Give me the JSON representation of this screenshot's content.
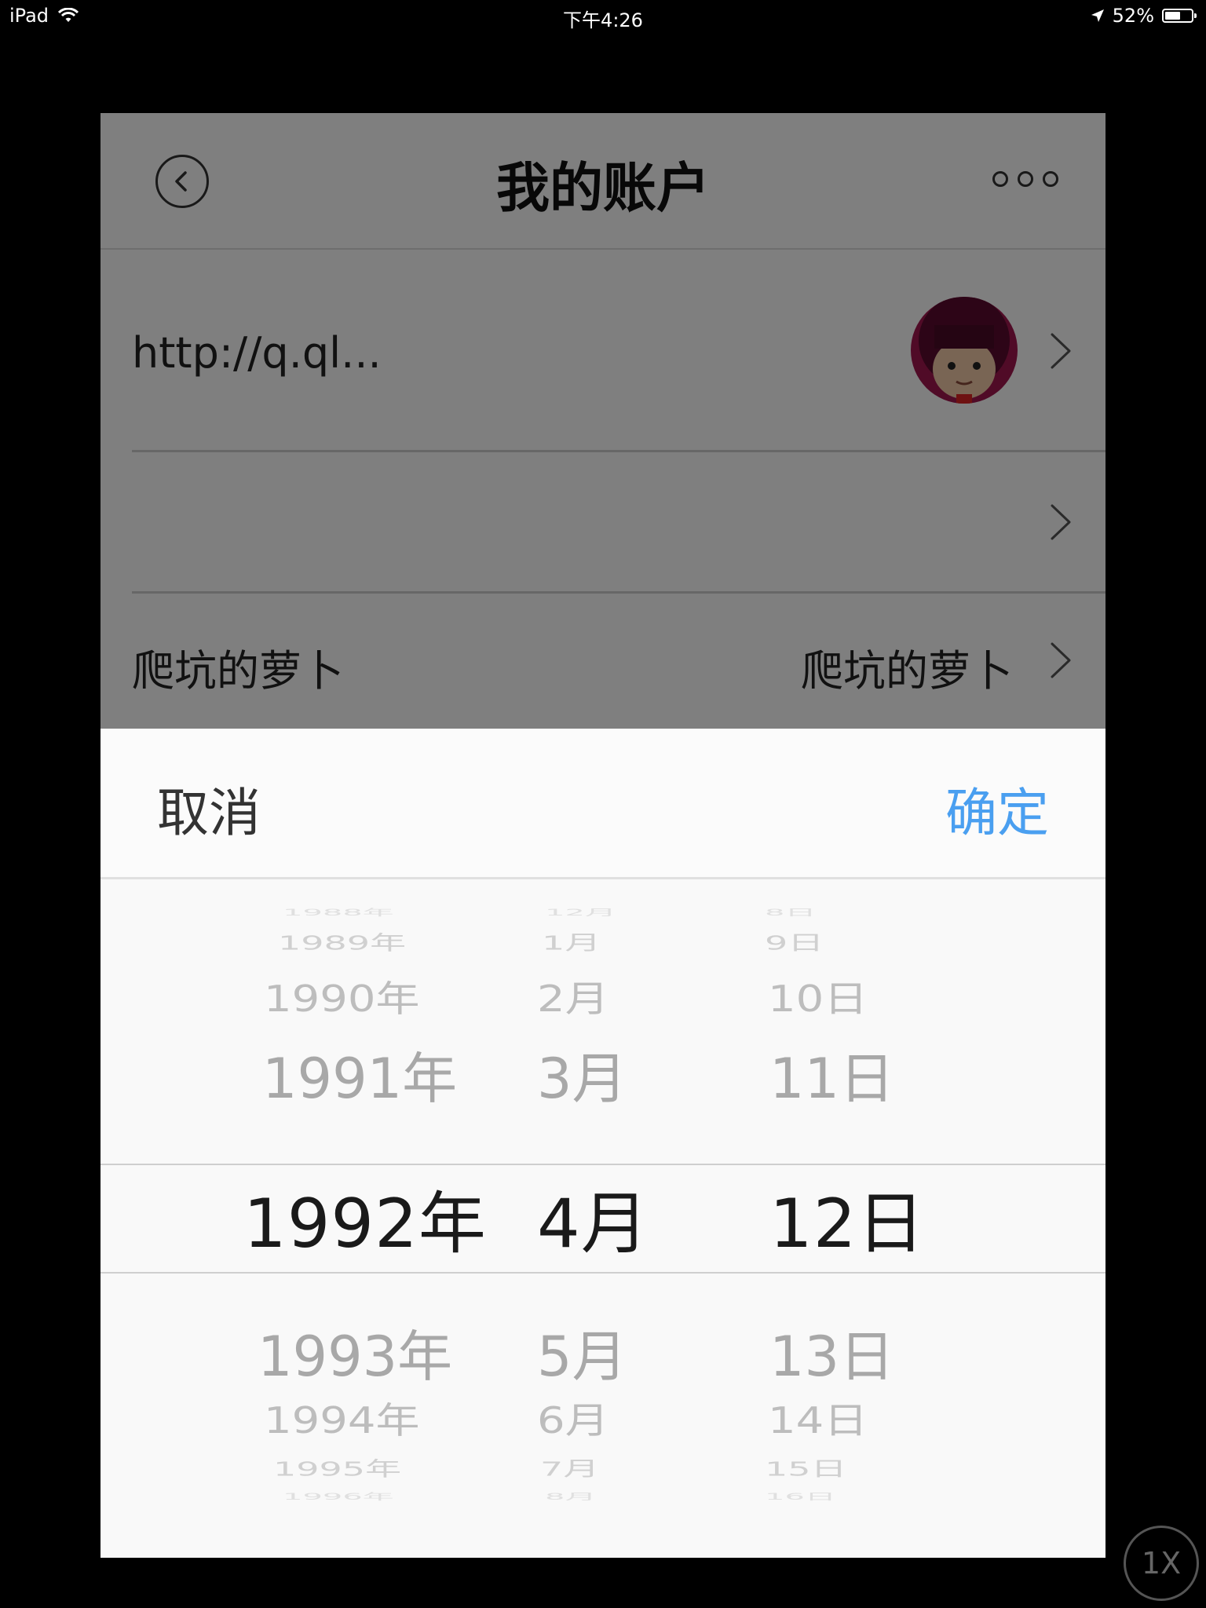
{
  "status_bar": {
    "device": "iPad",
    "time": "下午4:26",
    "battery_level": "52%"
  },
  "navbar": {
    "title": "我的账户",
    "back_icon": "back-circle-icon",
    "more_icon": "more-dots-icon"
  },
  "rows": [
    {
      "label": "http://q.ql...",
      "value": "",
      "avatar": "avatar-cartoon-boy"
    },
    {
      "label": "",
      "value": ""
    },
    {
      "label": "爬坑的萝卜",
      "value": "爬坑的萝卜"
    }
  ],
  "picker_toolbar": {
    "cancel_label": "取消",
    "confirm_label": "确定",
    "confirm_color": "#4a9ff0"
  },
  "date_picker": {
    "years": [
      "1988年",
      "1989年",
      "1990年",
      "1991年",
      "1992年",
      "1993年",
      "1994年",
      "1995年",
      "1996年"
    ],
    "months": [
      "12月",
      "1月",
      "2月",
      "3月",
      "4月",
      "5月",
      "6月",
      "7月",
      "8月"
    ],
    "days": [
      "8日",
      "9日",
      "10日",
      "11日",
      "12日",
      "13日",
      "14日",
      "15日",
      "16日"
    ],
    "selected": {
      "year": "1992年",
      "month": "4月",
      "day": "12日"
    }
  },
  "zoom_badge": "1X"
}
